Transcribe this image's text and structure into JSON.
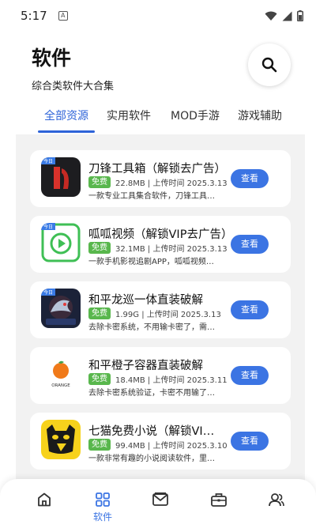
{
  "status_bar": {
    "time": "5:17",
    "notif_glyph": "A"
  },
  "header": {
    "title": "软件",
    "subtitle": "综合类软件大合集"
  },
  "tabs": [
    {
      "label": "全部资源",
      "active": true
    },
    {
      "label": "实用软件",
      "active": false
    },
    {
      "label": "MOD手游",
      "active": false
    },
    {
      "label": "游戏辅助",
      "active": false
    }
  ],
  "apps": [
    {
      "name": "刀锋工具箱（解锁去广告）",
      "badge": "免费",
      "meta": "22.8MB | 上传时间 2025.3.13",
      "desc": "一款专业工具集合软件，刀锋工具箱，海量实用工具",
      "button": "查看",
      "icon": "blade-toolbox-icon",
      "icon_label": "今日"
    },
    {
      "name": "呱呱视频（解锁VIP去广告）",
      "badge": "免费",
      "meta": "32.1MB | 上传时间 2025.3.13",
      "desc": "一款手机影视追剧APP，呱呱视频，海量影视资源",
      "button": "查看",
      "icon": "guagua-video-icon",
      "icon_label": "今日"
    },
    {
      "name": "和平龙巡一体直装破解",
      "badge": "免费",
      "meta": "1.99G | 上传时间 2025.3.13",
      "desc": "去除卡密系统，不用输卡密了，需要将正版卸载",
      "button": "查看",
      "icon": "dragon-game-icon",
      "icon_label": "今日"
    },
    {
      "name": "和平橙子容器直装破解",
      "badge": "免费",
      "meta": "18.4MB | 上传时间 2025.3.11",
      "desc": "去除卡密系统验证，卡密不用输了，需要卸载正版",
      "button": "查看",
      "icon": "orange-container-icon",
      "icon_label": "ORANGE"
    },
    {
      "name": "七猫免费小说（解锁VIP去广告）",
      "badge": "免费",
      "meta": "99.4MB | 上传时间 2025.3.10",
      "desc": "一款非常有趣的小说阅读软件，里面汇聚了海量小说",
      "button": "查看",
      "icon": "qimao-novel-icon",
      "icon_label": ""
    }
  ],
  "bottom_nav": [
    {
      "label": "",
      "icon": "home-icon",
      "active": false
    },
    {
      "label": "软件",
      "icon": "grid-icon",
      "active": true
    },
    {
      "label": "",
      "icon": "mail-icon",
      "active": false
    },
    {
      "label": "",
      "icon": "toolbox-icon",
      "active": false
    },
    {
      "label": "",
      "icon": "users-icon",
      "active": false
    }
  ],
  "colors": {
    "accent": "#3b74e3",
    "badge": "#59b74d",
    "content_bg": "#f2f2f2"
  }
}
